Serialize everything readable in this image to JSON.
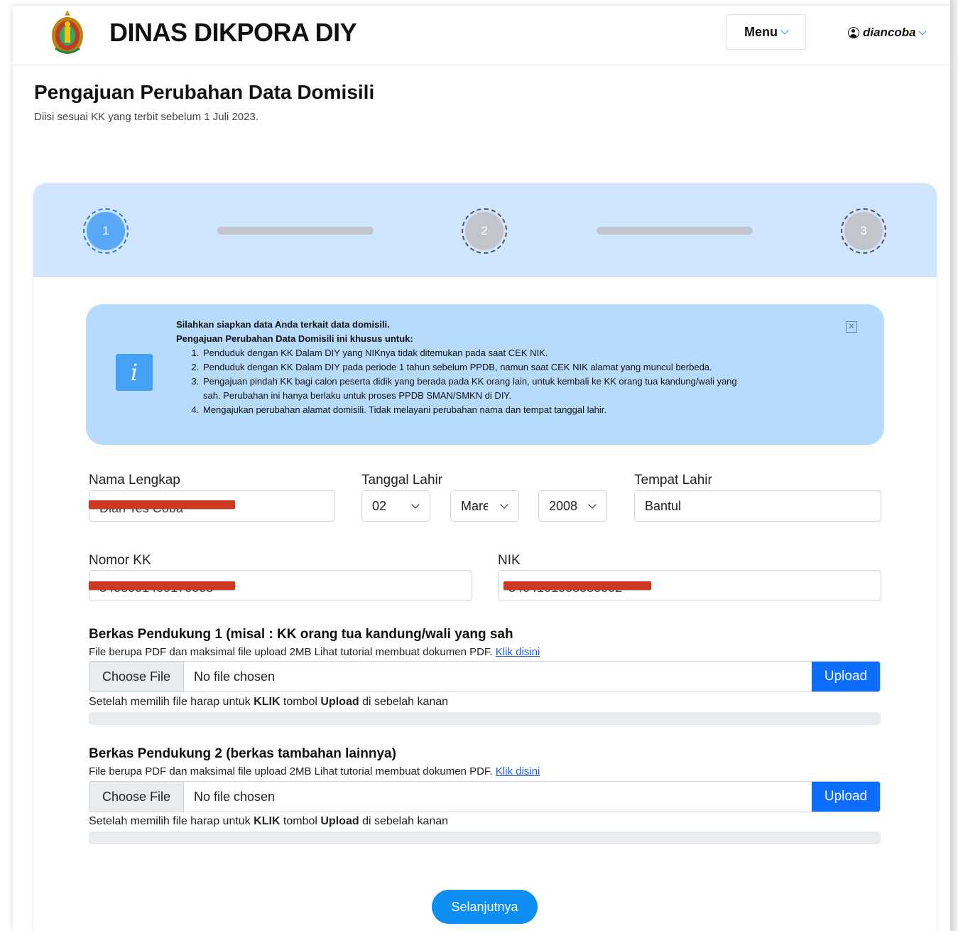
{
  "header": {
    "brand": "DINAS DIKPORA DIY",
    "menu_label": "Menu",
    "username": "diancoba"
  },
  "page": {
    "title": "Pengajuan Perubahan Data Domisili",
    "subtitle": "Diisi sesuai KK yang terbit sebelum 1 Juli 2023."
  },
  "stepper": {
    "steps": [
      "1",
      "2",
      "3"
    ],
    "active_step": 1
  },
  "alert": {
    "line1": "Silahkan siapkan data Anda terkait data domisili.",
    "line2": "Pengajuan Perubahan Data Domisili ini khusus untuk:",
    "items": [
      "Penduduk dengan KK Dalam DIY yang NIKnya tidak ditemukan pada saat CEK NIK.",
      "Penduduk dengan KK Dalam DIY pada periode 1 tahun sebelum PPDB, namun saat CEK NIK alamat yang muncul berbeda.",
      "Pengajuan pindah KK bagi calon peserta didik yang berada pada KK orang lain, untuk kembali ke KK orang tua kandung/wali yang sah. Perubahan ini hanya berlaku untuk proses PPDB SMAN/SMKN di DIY.",
      "Mengajukan perubahan alamat domisili. Tidak melayani perubahan nama dan tempat tanggal lahir."
    ],
    "close_symbol": "✕"
  },
  "form": {
    "nama_label": "Nama Lengkap",
    "nama_value": "Dian Tes Coba",
    "tanggal_label": "Tanggal Lahir",
    "day_value": "02",
    "month_value": "Mare",
    "year_value": "2008",
    "tempat_label": "Tempat Lahir",
    "tempat_value": "Bantul",
    "kk_label": "Nomor KK",
    "kk_value": "3403001409170003",
    "nik_label": "NIK",
    "nik_value": "3404101008080002"
  },
  "uploads": [
    {
      "title": "Berkas Pendukung 1 (misal : KK orang tua kandung/wali yang sah",
      "note": "File berupa PDF dan maksimal file upload 2MB Lihat tutorial membuat dokumen PDF.",
      "link": "Klik disini",
      "choose": "Choose File",
      "chosen": "No file chosen",
      "upload": "Upload",
      "after_pre": "Setelah memilih file harap untuk",
      "after_klik": "KLIK",
      "after_mid": "tombol",
      "after_upload": "Upload",
      "after_post": "di sebelah kanan",
      "progress": 0
    },
    {
      "title": "Berkas Pendukung 2 (berkas tambahan lainnya)",
      "note": "File berupa PDF dan maksimal file upload 2MB Lihat tutorial membuat dokumen PDF.",
      "link": "Klik disini",
      "choose": "Choose File",
      "chosen": "No file chosen",
      "upload": "Upload",
      "after_pre": "Setelah memilih file harap untuk",
      "after_klik": "KLIK",
      "after_mid": "tombol",
      "after_upload": "Upload",
      "after_post": "di sebelah kanan",
      "progress": 0
    }
  ],
  "next_button": "Selanjutnya",
  "colors": {
    "accent": "#0d6efd",
    "stepper_bg": "#cfe6fe",
    "alert_bg": "#b6dbfc",
    "redaction": "#cd3a1f"
  }
}
